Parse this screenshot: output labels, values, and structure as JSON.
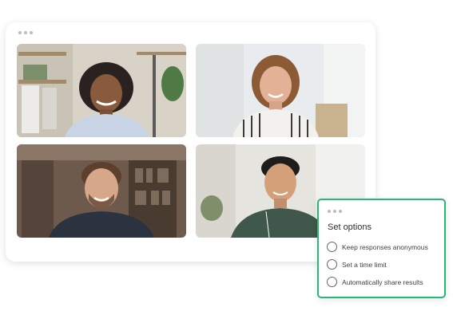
{
  "video_grid": {
    "tiles": [
      {
        "participant": "woman-curly-hair",
        "bg": "#d8d2c7"
      },
      {
        "participant": "woman-striped-shirt",
        "bg": "#e9ecee"
      },
      {
        "participant": "man-beard",
        "bg": "#6e5a4c"
      },
      {
        "participant": "man-green-shirt",
        "bg": "#e6e4de"
      }
    ]
  },
  "options_panel": {
    "title": "Set options",
    "options": [
      {
        "label": "Keep responses anonymous",
        "checked": false
      },
      {
        "label": "Set a time limit",
        "checked": false
      },
      {
        "label": "Automatically share results",
        "checked": false
      }
    ],
    "accent": "#2ab57a"
  }
}
